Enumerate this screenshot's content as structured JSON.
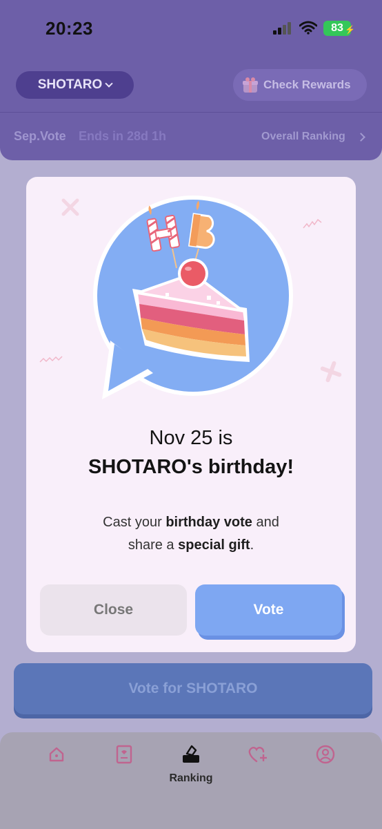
{
  "status_bar": {
    "time": "20:23",
    "battery": "83"
  },
  "header": {
    "artist_selector": "SHOTARO",
    "rewards_button": "Check Rewards"
  },
  "vote_info": {
    "title": "Sep.Vote",
    "ends": "Ends in 28d 1h",
    "overall_link": "Overall Ranking"
  },
  "main": {
    "vote_for_button": "Vote for SHOTARO"
  },
  "tabbar": {
    "active_label": "Ranking",
    "icons": [
      "home-icon",
      "card-icon",
      "ranking-icon",
      "heart-plus-icon",
      "profile-icon"
    ]
  },
  "modal": {
    "cake_letters": "HB",
    "line1": "Nov 25 is",
    "line2": "SHOTARO's birthday!",
    "desc_prefix": "Cast your ",
    "desc_bold1": "birthday vote",
    "desc_mid": " and",
    "desc_prefix2": "share a ",
    "desc_bold2": "special gift",
    "desc_suffix": ".",
    "close_label": "Close",
    "vote_label": "Vote"
  },
  "colors": {
    "vote_button": "#7ea7f2",
    "modal_bg": "#f9effa",
    "header_bg": "#6d5fa8"
  }
}
